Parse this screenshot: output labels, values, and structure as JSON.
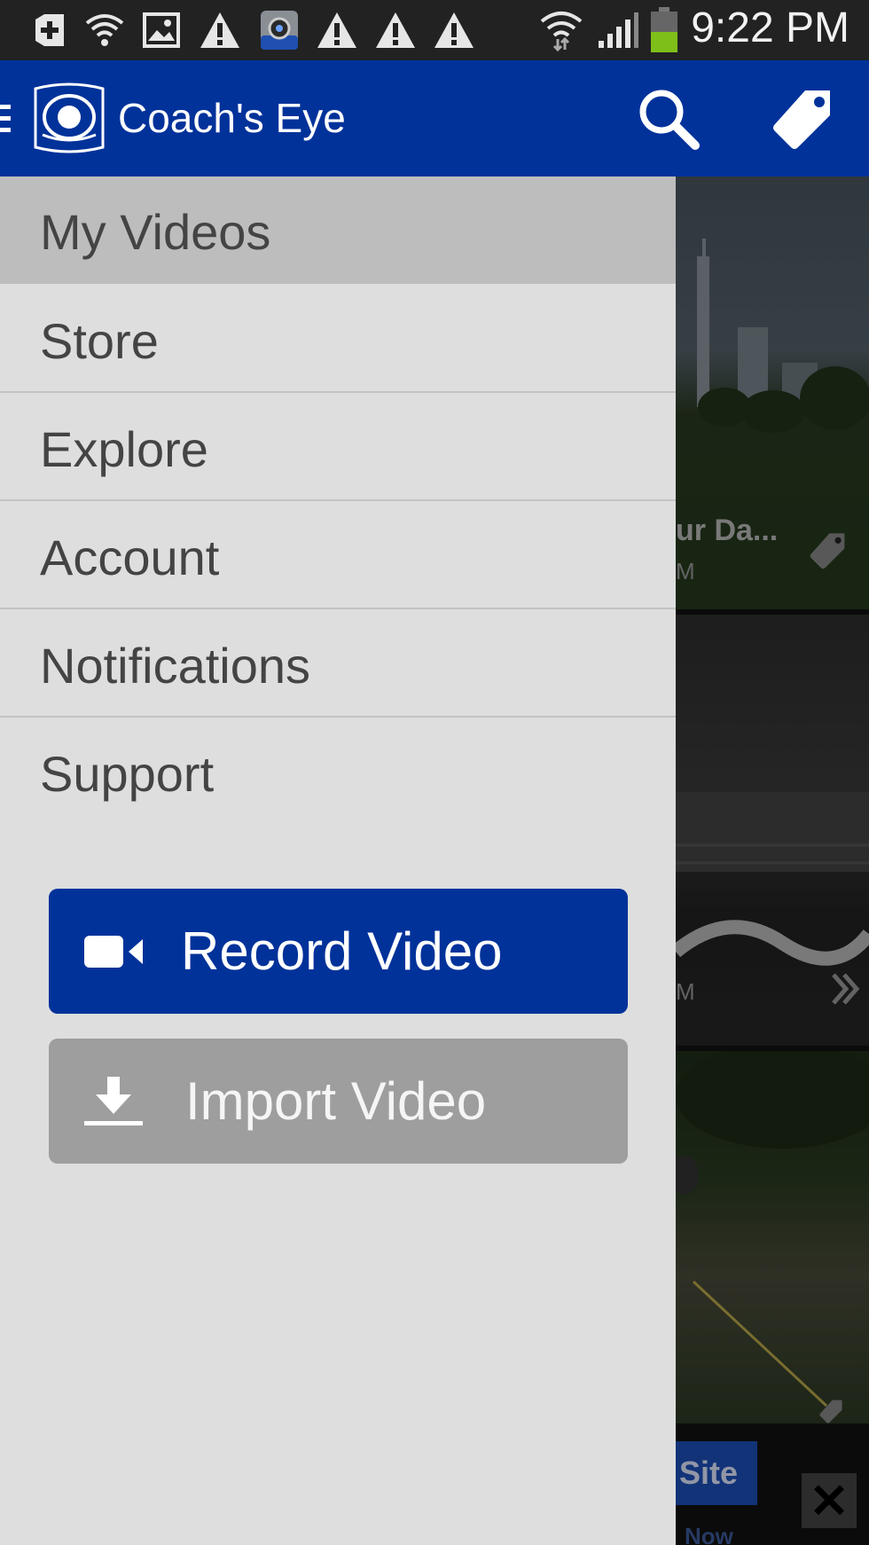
{
  "status_bar": {
    "time": "9:22 PM",
    "icons": [
      "add-box-icon",
      "wifi-question-icon",
      "image-icon",
      "warning-icon",
      "camera-app-icon",
      "warning-icon",
      "warning-icon",
      "warning-icon",
      "wifi-icon",
      "signal-icon",
      "battery-icon"
    ]
  },
  "app_bar": {
    "title": "Coach's Eye",
    "icons": [
      "menu-icon",
      "coachs-eye-logo-icon",
      "search-icon",
      "tag-icon"
    ]
  },
  "drawer": {
    "items": [
      {
        "label": "My Videos",
        "selected": true
      },
      {
        "label": "Store"
      },
      {
        "label": "Explore"
      },
      {
        "label": "Account"
      },
      {
        "label": "Notifications"
      },
      {
        "label": "Support"
      }
    ],
    "record_button": {
      "label": "Record Video",
      "icon": "video-camera-icon"
    },
    "import_button": {
      "label": "Import Video",
      "icon": "download-icon"
    }
  },
  "background_list": {
    "items": [
      {
        "caption": "ur Da...",
        "sub": "M",
        "icon": "tag-icon"
      },
      {
        "caption": "",
        "sub": "M",
        "icon": "double-chevron-right-icon"
      },
      {
        "caption": "",
        "sub": "",
        "icon": "tag-icon"
      }
    ],
    "ad": {
      "button_label": "Site",
      "close_label": "✕",
      "sub_label": "Now"
    }
  },
  "colors": {
    "app_bar": "#00329a",
    "drawer_bg": "#dedede",
    "selected_item": "#bdbdbd",
    "record_button": "#00329a",
    "import_button": "#9e9e9e"
  }
}
